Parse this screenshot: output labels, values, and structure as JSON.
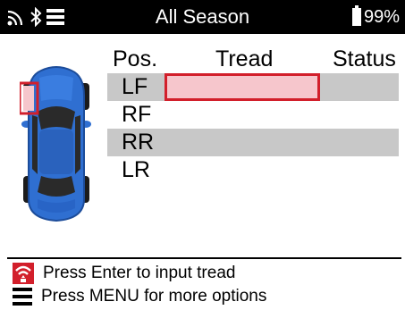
{
  "status_bar": {
    "title": "All Season",
    "battery": "99%",
    "icons": [
      "wireless-signal-icon",
      "bluetooth-icon",
      "menu-icon",
      "battery-icon"
    ]
  },
  "vehicle": {
    "icon": "car-top-view-icon",
    "body_color": "#2f6fd1",
    "highlighted_tire": "LF"
  },
  "table": {
    "headers": {
      "pos": "Pos.",
      "tread": "Tread",
      "status": "Status"
    },
    "rows": [
      {
        "pos": "LF",
        "tread": "",
        "status": "",
        "selected": true
      },
      {
        "pos": "RF",
        "tread": "",
        "status": "",
        "selected": false
      },
      {
        "pos": "RR",
        "tread": "",
        "status": "",
        "selected": false
      },
      {
        "pos": "LR",
        "tread": "",
        "status": "",
        "selected": false
      }
    ]
  },
  "hints": {
    "enter": {
      "icon": "sensor-wave-icon",
      "text": "Press Enter to input tread"
    },
    "menu": {
      "icon": "menu-icon",
      "text": "Press MENU for more options"
    }
  },
  "colors": {
    "accent_red": "#d21f2b",
    "selected_fill": "#f6c6cc",
    "row_shade": "#c8c8c8",
    "status_bar": "#000000"
  }
}
